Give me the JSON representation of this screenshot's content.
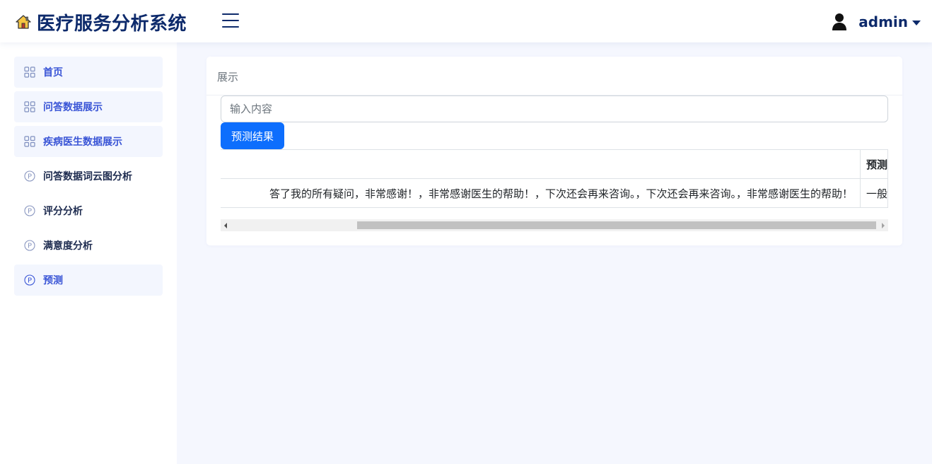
{
  "header": {
    "app_title": "医疗服务分析系统",
    "brand_icon": "home-icon",
    "menu_icon": "hamburger-menu-icon",
    "user_name": "admin",
    "user_icon": "user-icon",
    "title_color": "#0d2a6b"
  },
  "sidebar": {
    "items": [
      {
        "label": "首页",
        "icon": "grid-icon",
        "style": "active-tinted",
        "color": "#3a55d6"
      },
      {
        "label": "问答数据展示",
        "icon": "grid-icon",
        "style": "tinted",
        "color": "#3a55d6"
      },
      {
        "label": "疾病医生数据展示",
        "icon": "grid-icon",
        "style": "tinted",
        "color": "#3a55d6"
      },
      {
        "label": "问答数据词云图分析",
        "icon": "circle-p-icon",
        "style": "plain",
        "color": "#1c2a4e"
      },
      {
        "label": "评分分析",
        "icon": "circle-p-icon",
        "style": "plain",
        "color": "#1c2a4e"
      },
      {
        "label": "满意度分析",
        "icon": "circle-p-icon",
        "style": "plain",
        "color": "#1c2a4e"
      },
      {
        "label": "预测",
        "icon": "circle-p-icon",
        "style": "tinted",
        "color": "#3a55d6"
      }
    ]
  },
  "main": {
    "card_title": "展示",
    "input": {
      "placeholder": "输入内容",
      "value": ""
    },
    "predict_button": "预测结果",
    "button_color": "#0d6efd",
    "table": {
      "columns": [
        "",
        "预测"
      ],
      "rows": [
        {
          "text": "答了我的所有疑问，非常感谢！，非常感谢医生的帮助！，下次还会再来咨询。，下次还会再来咨询。，非常感谢医生的帮助！",
          "prediction": "一般"
        }
      ]
    }
  }
}
